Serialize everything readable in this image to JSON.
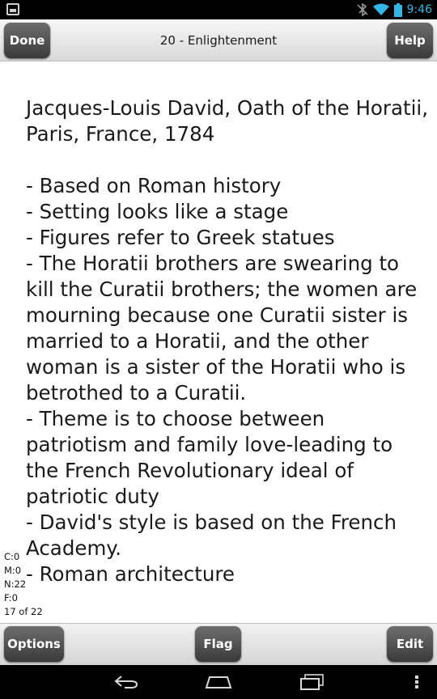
{
  "status_bar": {
    "time": "9:46",
    "icons": [
      "notification-app-icon",
      "bluetooth-off-icon",
      "wifi-icon",
      "battery-icon"
    ],
    "accent_color": "#33b5e5"
  },
  "header": {
    "done_label": "Done",
    "title": "20 - Enlightenment",
    "help_label": "Help"
  },
  "card": {
    "text": "Jacques-Louis David, Oath of the Horatii, Paris, France, 1784\n\n- Based on Roman history\n- Setting looks like a stage\n- Figures refer to Greek statues\n- The Horatii brothers are swearing to kill the Curatii brothers; the women are mourning because one Curatii sister is married to a Horatii, and the other woman is a sister of the Horatii who is betrothed to a Curatii.\n- Theme is to choose between patriotism and family love-leading to the French Revolutionary ideal of patriotic duty\n- David's style is based on the French Academy.\n- Roman architecture"
  },
  "stats": {
    "c": "C:0",
    "m": "M:0",
    "n": "N:22",
    "f": "F:0",
    "position": "17 of 22"
  },
  "toolbar": {
    "options_label": "Options",
    "flag_label": "Flag",
    "edit_label": "Edit"
  },
  "nav_bar": {
    "icons": [
      "back-icon",
      "home-icon",
      "recent-apps-icon",
      "overflow-menu-icon"
    ]
  }
}
